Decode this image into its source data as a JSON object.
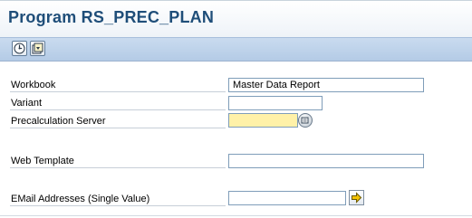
{
  "page": {
    "title": "Program RS_PREC_PLAN"
  },
  "toolbar": {
    "buttons": [
      {
        "icon": "execute-icon",
        "tooltip": "Execute"
      },
      {
        "icon": "get-variant-icon",
        "tooltip": "Get Variant"
      }
    ]
  },
  "form": {
    "workbook": {
      "label": "Workbook",
      "value": "Master Data Report"
    },
    "variant": {
      "label": "Variant",
      "value": ""
    },
    "precalc_server": {
      "label": "Precalculation Server",
      "value": ""
    },
    "web_template": {
      "label": "Web Template",
      "value": ""
    },
    "email": {
      "label": "EMail Addresses (Single Value)",
      "value": ""
    }
  },
  "colors": {
    "title": "#1f4e79",
    "toolbar": "#c0d4ec",
    "required_field": "#fff1a8",
    "multi_select_arrow": "#f2c200"
  }
}
